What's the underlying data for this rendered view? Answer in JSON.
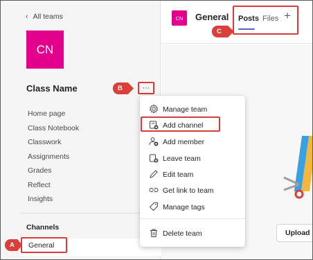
{
  "sidebar": {
    "back_label": "All teams",
    "team_initials": "CN",
    "class_name": "Class Name",
    "more_label": "···",
    "nav_items": [
      "Home page",
      "Class Notebook",
      "Classwork",
      "Assignments",
      "Grades",
      "Reflect",
      "Insights"
    ],
    "channels_heading": "Channels",
    "channel_general": "General"
  },
  "header": {
    "avatar_initials": "CN",
    "title": "General",
    "tabs": [
      "Posts",
      "Files"
    ],
    "add_tab_icon": "plus-icon"
  },
  "main": {
    "upload_button": "Upload C"
  },
  "context_menu": {
    "items": [
      {
        "label": "Manage team",
        "icon": "gear-icon"
      },
      {
        "label": "Add channel",
        "icon": "add-channel-icon"
      },
      {
        "label": "Add member",
        "icon": "add-member-icon"
      },
      {
        "label": "Leave team",
        "icon": "leave-team-icon"
      },
      {
        "label": "Edit team",
        "icon": "pencil-icon"
      },
      {
        "label": "Get link to team",
        "icon": "link-icon"
      },
      {
        "label": "Manage tags",
        "icon": "tag-icon"
      },
      {
        "label": "Delete team",
        "icon": "trash-icon"
      }
    ]
  },
  "callouts": {
    "a": "A",
    "b": "B",
    "c": "C"
  },
  "colors": {
    "accent_magenta": "#e3008c",
    "callout_red": "#d83b3b",
    "tab_underline": "#5b5fc7"
  }
}
